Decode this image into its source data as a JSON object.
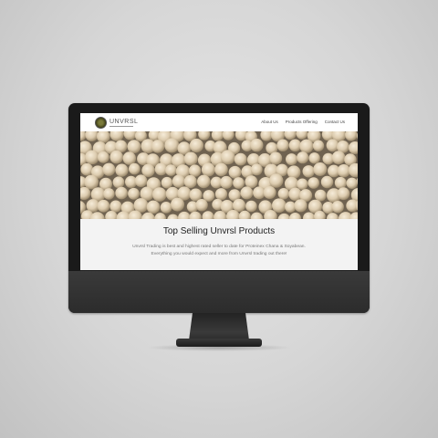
{
  "site": {
    "logo_text": "UNVRSL",
    "nav": [
      "About Us",
      "Products Offering",
      "Contact Us"
    ],
    "headline": "Top Selling Unvrsl Products",
    "description_lines": [
      "Unvrsl Trading is best and highest rated seller to date for Proteinex Chana & Soyabean.",
      "Everything you would expect and more from Unvrsl trading out there!"
    ]
  },
  "icons": {
    "logo": "logo-emblem-icon"
  },
  "colors": {
    "background": "#d6d6d6",
    "monitor": "#1a1a1a",
    "header_bg": "#ffffff",
    "content_bg": "#f3f3f3",
    "headline": "#222222",
    "description": "#777777"
  }
}
